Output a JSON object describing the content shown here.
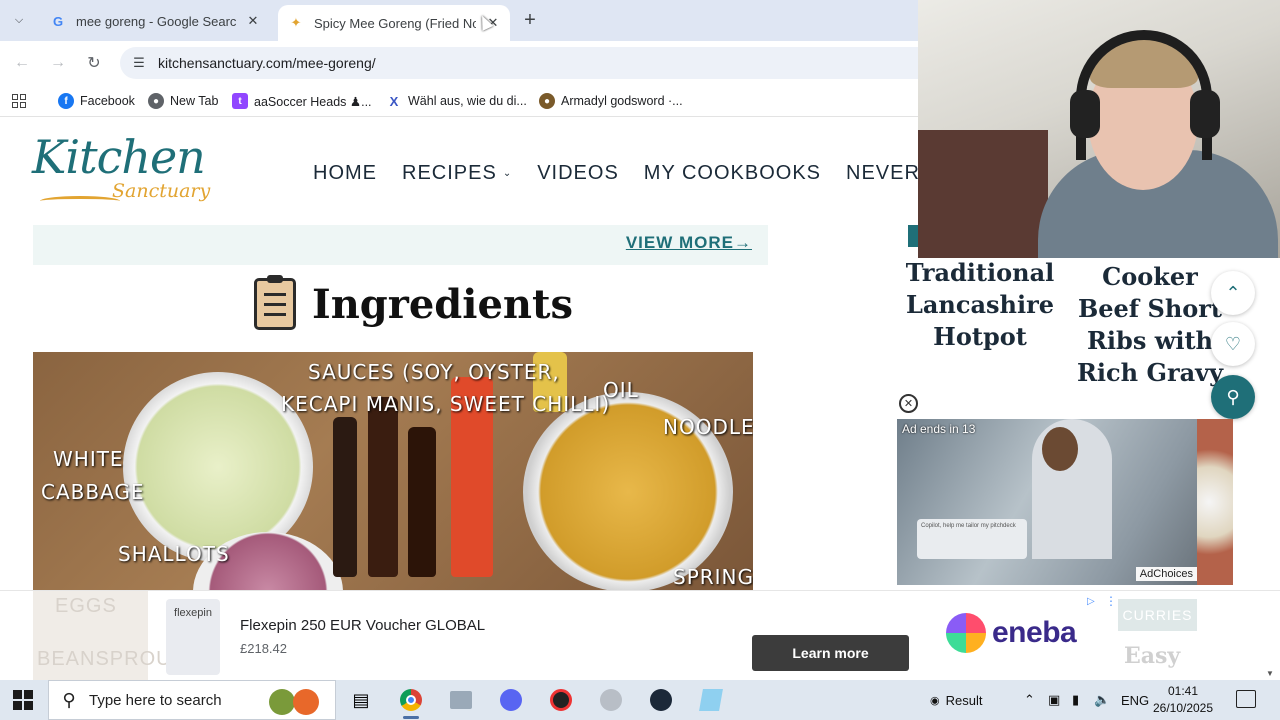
{
  "browser": {
    "tabs": [
      {
        "title": "mee goreng - Google Search",
        "favicon": "G",
        "active": false
      },
      {
        "title": "Spicy Mee Goreng (Fried Noodles)",
        "favicon": "whisk-icon",
        "active": true
      }
    ],
    "url": "kitchensanctuary.com/mee-goreng/",
    "bookmarks": [
      {
        "label": "Facebook",
        "icon": "facebook-icon",
        "color": "#1877f2"
      },
      {
        "label": "New Tab",
        "icon": "globe-icon",
        "color": "#5f6368"
      },
      {
        "label": "aaSoccer Heads ♟...",
        "icon": "twitch-icon",
        "color": "#9146ff"
      },
      {
        "label": "Wähl aus, wie du di...",
        "icon": "x-brand-icon",
        "color": "#3a56c4"
      },
      {
        "label": "Armadyl godsword ·...",
        "icon": "runescape-icon",
        "color": "#7a5a2a"
      }
    ]
  },
  "site": {
    "logo_main": "Kitchen",
    "logo_sub": "Sanctuary",
    "nav": [
      "HOME",
      "RECIPES",
      "VIDEOS",
      "MY COOKBOOKS",
      "NEVER MIS"
    ],
    "view_more": "VIEW MORE→",
    "ingredients_heading": "Ingredients",
    "photo_labels": {
      "sauces": "SAUCES (SOY, OYSTER,",
      "sauces2": "KECAPI MANIS, SWEET CHILLI)",
      "oil": "OIL",
      "white": "WHITE",
      "cabbage": "CABBAGE",
      "noodles": "NOODLES",
      "shallots": "SHALLOTS",
      "spring": "SPRING"
    },
    "related": [
      {
        "title": "Traditional Lancashire Hotpot"
      },
      {
        "title": "Cooker Beef Short Ribs with Rich Gravy"
      }
    ]
  },
  "video_ad": {
    "countdown": "Ad ends in 13",
    "laptop_text": "Copilot, help me tailor my pitchdeck",
    "adchoices": "AdChoices"
  },
  "banner_ad": {
    "brand_thumb": "flexepin",
    "title": "Flexepin 250 EUR Voucher GLOBAL",
    "price": "£218.42",
    "cta": "Learn more",
    "advertiser": "eneba",
    "behind_left_1": "EGGS",
    "behind_left_2": "BEANSPROUTS",
    "behind_right_chip": "CURRIES",
    "behind_right_text": "Easy"
  },
  "taskbar": {
    "search_placeholder": "Type here to search",
    "tray_app": "Result",
    "language": "ENG",
    "time": "01:41",
    "date": "26/10/2025"
  }
}
